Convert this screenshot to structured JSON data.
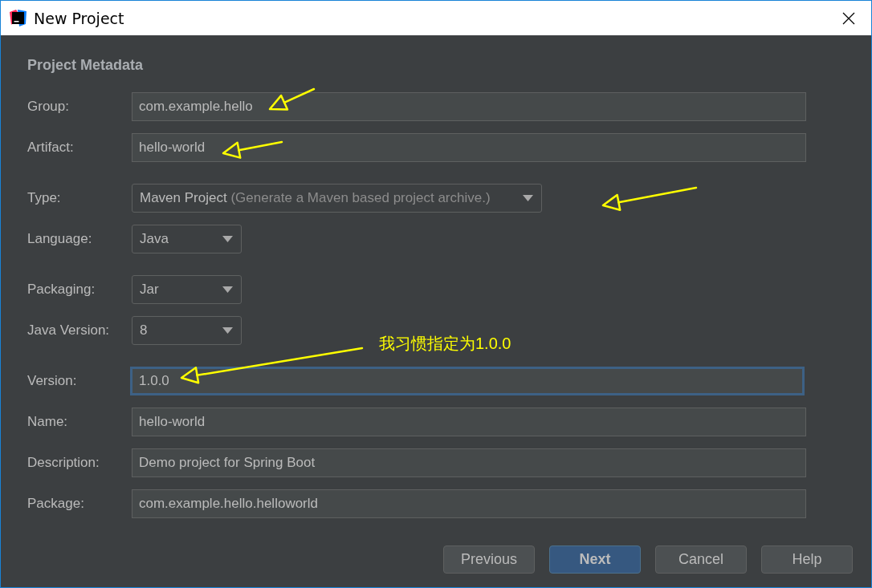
{
  "window": {
    "title": "New Project"
  },
  "section_title": "Project Metadata",
  "groups": [
    [
      {
        "label": "Group:",
        "kind": "text",
        "value": "com.example.hello",
        "focused": false
      },
      {
        "label": "Artifact:",
        "kind": "text",
        "value": "hello-world",
        "focused": false
      }
    ],
    [
      {
        "label": "Type:",
        "kind": "select",
        "value": "Maven Project",
        "hint": "(Generate a Maven based project archive.)"
      },
      {
        "label": "Language:",
        "kind": "select",
        "value": "Java"
      }
    ],
    [
      {
        "label": "Packaging:",
        "kind": "select",
        "value": "Jar"
      },
      {
        "label": "Java Version:",
        "kind": "select",
        "value": "8"
      }
    ],
    [
      {
        "label": "Version:",
        "kind": "text",
        "value": "1.0.0",
        "focused": true
      },
      {
        "label": "Name:",
        "kind": "text",
        "value": "hello-world",
        "focused": false
      },
      {
        "label": "Description:",
        "kind": "text",
        "value": "Demo project for Spring Boot",
        "focused": false
      },
      {
        "label": "Package:",
        "kind": "text",
        "value": "com.example.hello.helloworld",
        "focused": false
      }
    ]
  ],
  "annotation": {
    "note": "我习惯指定为1.0.0"
  },
  "buttons": [
    {
      "label": "Previous",
      "default": false
    },
    {
      "label": "Next",
      "default": true
    },
    {
      "label": "Cancel",
      "default": false
    },
    {
      "label": "Help",
      "default": false
    }
  ]
}
